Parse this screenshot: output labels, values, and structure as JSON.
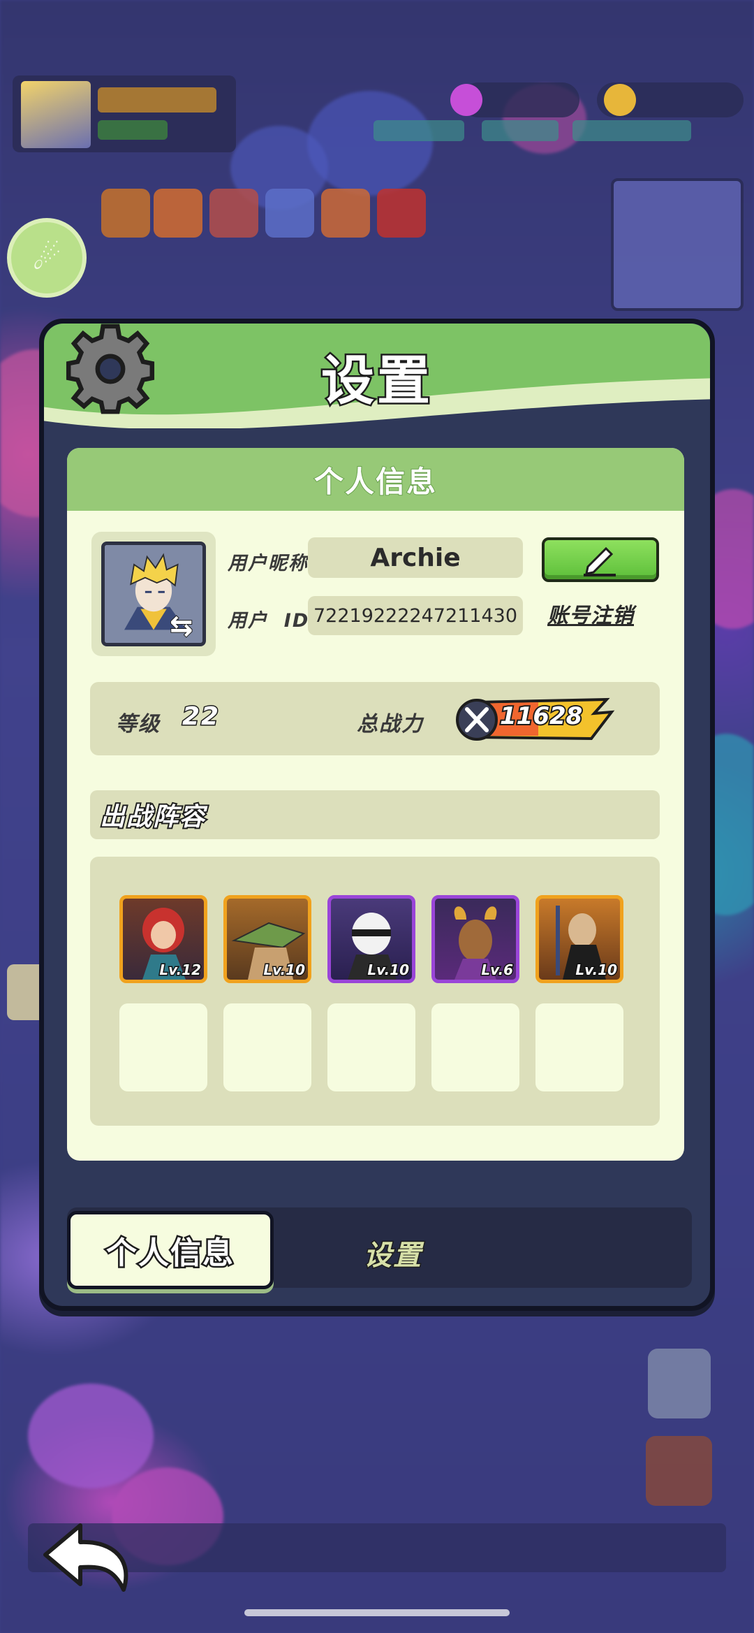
{
  "panel": {
    "title": "设置"
  },
  "profile": {
    "section_title": "个人信息",
    "nickname_label": "用户昵称",
    "nickname_value": "Archie",
    "id_label": "用户  ID",
    "id_value": "72219222247211430",
    "edit_icon": "pencil-icon",
    "delete_account_label": "账号注销",
    "level_label": "等级",
    "level_value": "22",
    "power_label": "总战力",
    "power_value": "11628"
  },
  "lineup": {
    "title": "出战阵容",
    "heroes": [
      {
        "level": "Lv.12",
        "rarity_color": "#f0a21e"
      },
      {
        "level": "Lv.10",
        "rarity_color": "#f0a21e"
      },
      {
        "level": "Lv.10",
        "rarity_color": "#9a45d8"
      },
      {
        "level": "Lv.6",
        "rarity_color": "#9a45d8"
      },
      {
        "level": "Lv.10",
        "rarity_color": "#f0a21e"
      }
    ],
    "empty_slots": 5
  },
  "tabs": [
    {
      "label": "个人信息",
      "active": true
    },
    {
      "label": "设置",
      "active": false
    }
  ],
  "colors": {
    "accent_green": "#7dc365",
    "card_bg": "#f6fcdf",
    "panel_dark": "#2f3859"
  }
}
